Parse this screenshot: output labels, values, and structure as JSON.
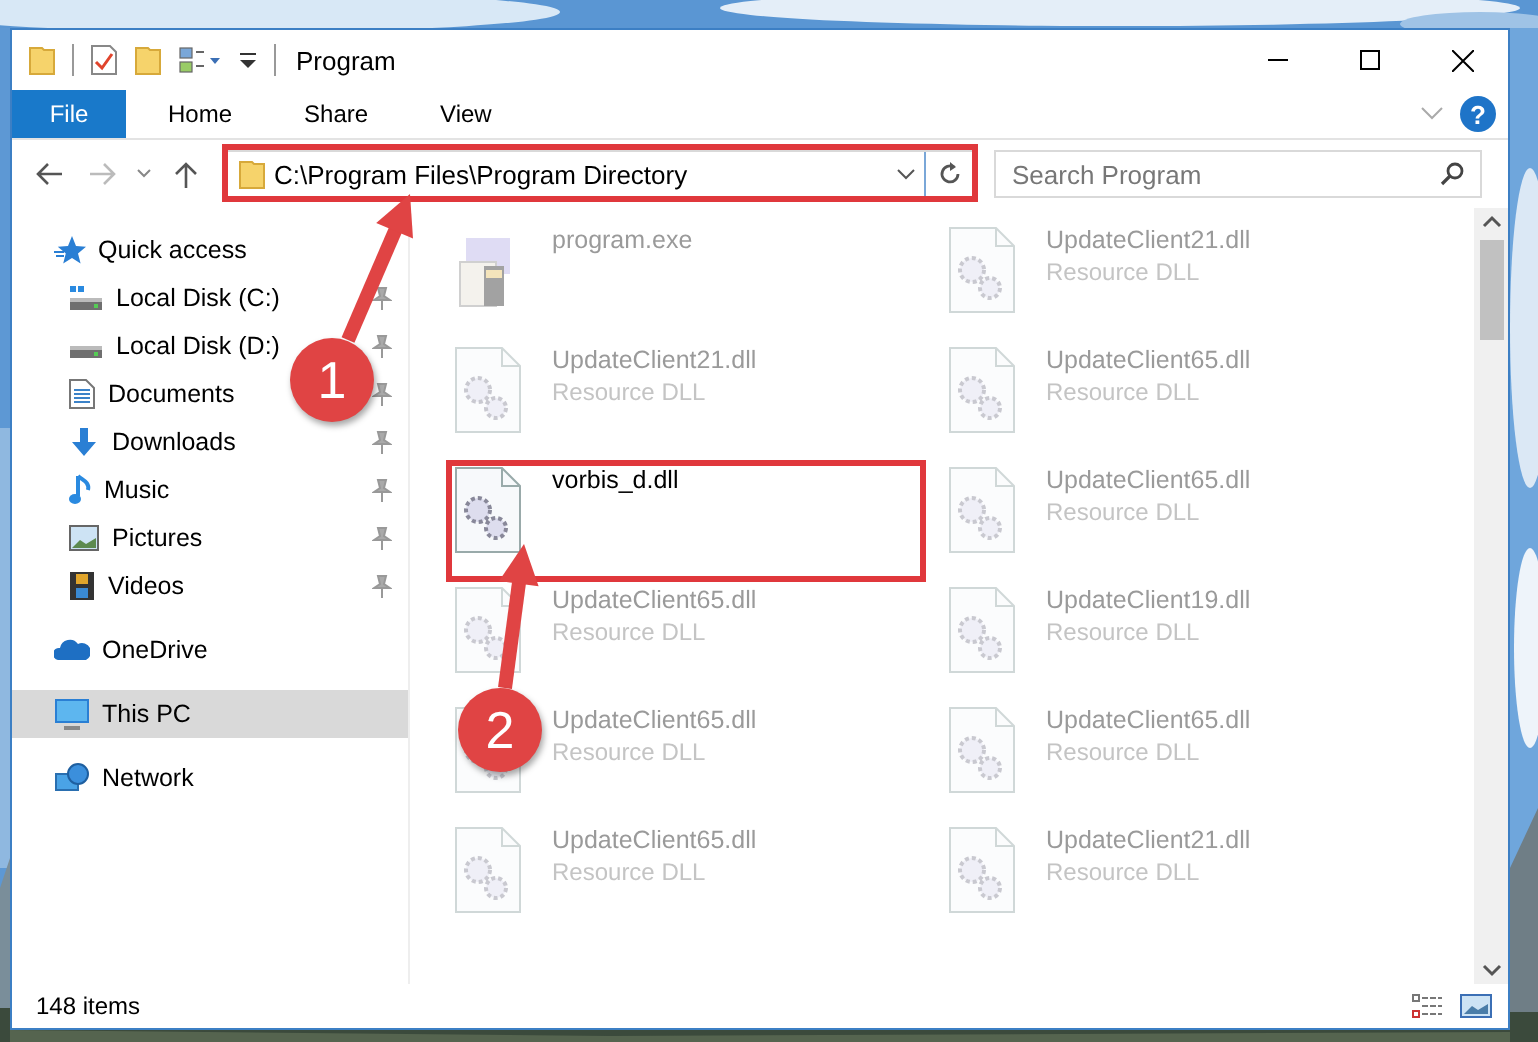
{
  "window": {
    "title": "Program"
  },
  "ribbon": {
    "file_button": "File",
    "tabs": [
      "Home",
      "Share",
      "View"
    ],
    "help_icon": "?"
  },
  "address_bar": {
    "path": "C:\\Program Files\\Program Directory"
  },
  "search": {
    "placeholder": "Search Program"
  },
  "navigation": [
    {
      "label": "Quick access",
      "selected": false,
      "children": [
        {
          "label": "Local Disk (C:)",
          "pinned": true,
          "selected": false
        },
        {
          "label": "Local Disk (D:)",
          "pinned": true,
          "selected": false
        },
        {
          "label": "Documents",
          "pinned": true,
          "selected": false
        },
        {
          "label": "Downloads",
          "pinned": true,
          "selected": false
        },
        {
          "label": "Music",
          "pinned": true,
          "selected": false
        },
        {
          "label": "Pictures",
          "pinned": true,
          "selected": false
        },
        {
          "label": "Videos",
          "pinned": true,
          "selected": false
        }
      ]
    },
    {
      "label": "OneDrive",
      "selected": false
    },
    {
      "label": "This PC",
      "selected": true
    },
    {
      "label": "Network",
      "selected": false
    }
  ],
  "files": [
    {
      "name": "program.exe",
      "kind": "exe",
      "dimmed": true
    },
    {
      "name": "UpdateClient21.dll",
      "type": "Resource DLL",
      "kind": "dll",
      "dimmed": true
    },
    {
      "name": "UpdateClient21.dll",
      "type": "Resource DLL",
      "kind": "dll",
      "dimmed": true
    },
    {
      "name": "UpdateClient65.dll",
      "type": "Resource DLL",
      "kind": "dll",
      "dimmed": true
    },
    {
      "name": "vorbis_d.dll",
      "kind": "dll",
      "dimmed": false
    },
    {
      "name": "UpdateClient65.dll",
      "type": "Resource DLL",
      "kind": "dll",
      "dimmed": true
    },
    {
      "name": "UpdateClient65.dll",
      "type": "Resource DLL",
      "kind": "dll",
      "dimmed": true
    },
    {
      "name": "UpdateClient19.dll",
      "type": "Resource DLL",
      "kind": "dll",
      "dimmed": true
    },
    {
      "name": "UpdateClient65.dll",
      "type": "Resource DLL",
      "kind": "dll",
      "dimmed": true
    },
    {
      "name": "UpdateClient65.dll",
      "type": "Resource DLL",
      "kind": "dll",
      "dimmed": true
    },
    {
      "name": "UpdateClient65.dll",
      "type": "Resource DLL",
      "kind": "dll",
      "dimmed": true
    },
    {
      "name": "UpdateClient21.dll",
      "type": "Resource DLL",
      "kind": "dll",
      "dimmed": true
    }
  ],
  "status_bar": {
    "item_count": "148 items"
  },
  "annotations": [
    {
      "label": "1"
    },
    {
      "label": "2"
    }
  ]
}
